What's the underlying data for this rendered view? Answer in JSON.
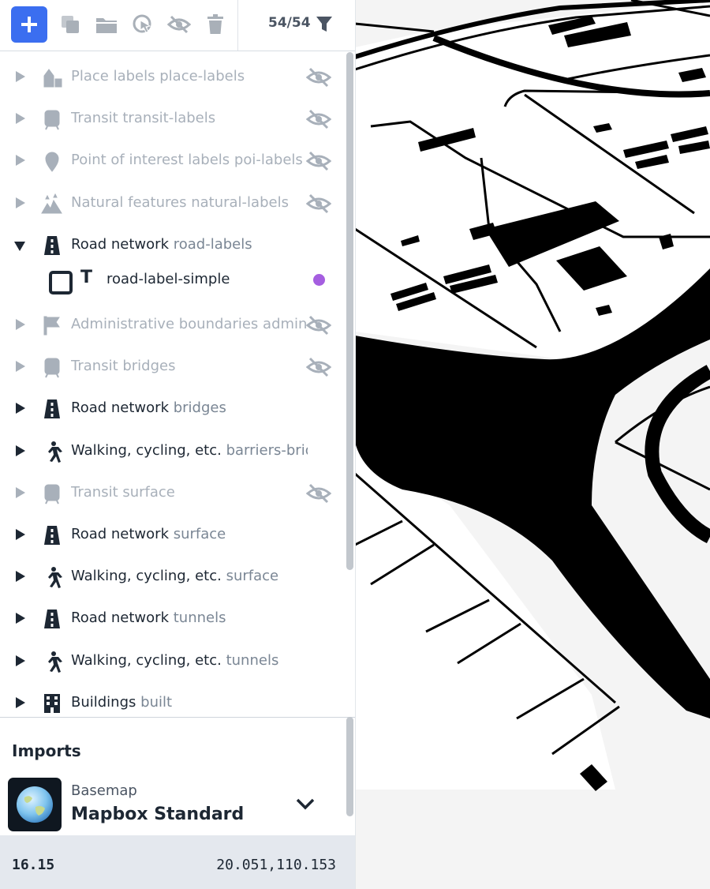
{
  "toolbar": {
    "add_icon": "plus-icon",
    "icons": [
      "duplicate-icon",
      "folder-icon",
      "select-cursor-icon",
      "hide-icon",
      "trash-icon"
    ],
    "layer_count": "54/54",
    "filter_icon": "filter-icon"
  },
  "layers": [
    {
      "name": "Place labels",
      "slot": "place-labels",
      "icon": "place-icon",
      "hidden": true,
      "expanded": false
    },
    {
      "name": "Transit",
      "slot": "transit-labels",
      "icon": "train-icon",
      "hidden": true,
      "expanded": false
    },
    {
      "name": "Point of interest labels",
      "slot": "poi-labels",
      "icon": "pin-icon",
      "hidden": true,
      "expanded": false
    },
    {
      "name": "Natural features",
      "slot": "natural-labels",
      "icon": "mountain-icon",
      "hidden": true,
      "expanded": false
    },
    {
      "name": "Road network",
      "slot": "road-labels",
      "icon": "road-icon",
      "hidden": false,
      "expanded": true
    },
    {
      "name": "Administrative boundaries",
      "slot": "admin",
      "icon": "flag-icon",
      "hidden": true,
      "expanded": false
    },
    {
      "name": "Transit",
      "slot": "bridges",
      "icon": "train-icon",
      "hidden": true,
      "expanded": false
    },
    {
      "name": "Road network",
      "slot": "bridges",
      "icon": "road-icon",
      "hidden": false,
      "expanded": false
    },
    {
      "name": "Walking, cycling, etc.",
      "slot": "barriers-bridges",
      "icon": "walker-icon",
      "hidden": false,
      "expanded": false
    },
    {
      "name": "Transit",
      "slot": "surface",
      "icon": "train-icon",
      "hidden": true,
      "expanded": false
    },
    {
      "name": "Road network",
      "slot": "surface",
      "icon": "road-icon",
      "hidden": false,
      "expanded": false
    },
    {
      "name": "Walking, cycling, etc.",
      "slot": "surface",
      "icon": "walker-icon",
      "hidden": false,
      "expanded": false
    },
    {
      "name": "Road network",
      "slot": "tunnels",
      "icon": "road-icon",
      "hidden": false,
      "expanded": false
    },
    {
      "name": "Walking, cycling, etc.",
      "slot": "tunnels",
      "icon": "walker-icon",
      "hidden": false,
      "expanded": false
    },
    {
      "name": "Buildings",
      "slot": "built",
      "icon": "building-icon",
      "hidden": false,
      "expanded": false
    }
  ],
  "sublayer": {
    "parent_index": 4,
    "type_icon": "T",
    "name": "road-label-simple",
    "dot_color": "#a55ee0"
  },
  "imports": {
    "title": "Imports",
    "basemap_label": "Basemap",
    "basemap_name": "Mapbox Standard"
  },
  "status": {
    "zoom": "16.15",
    "coords": "20.051,110.153"
  },
  "colors": {
    "accent": "#3b6ef0",
    "text": "#1d2733",
    "muted": "#a8b0ba",
    "purple": "#a55ee0"
  }
}
